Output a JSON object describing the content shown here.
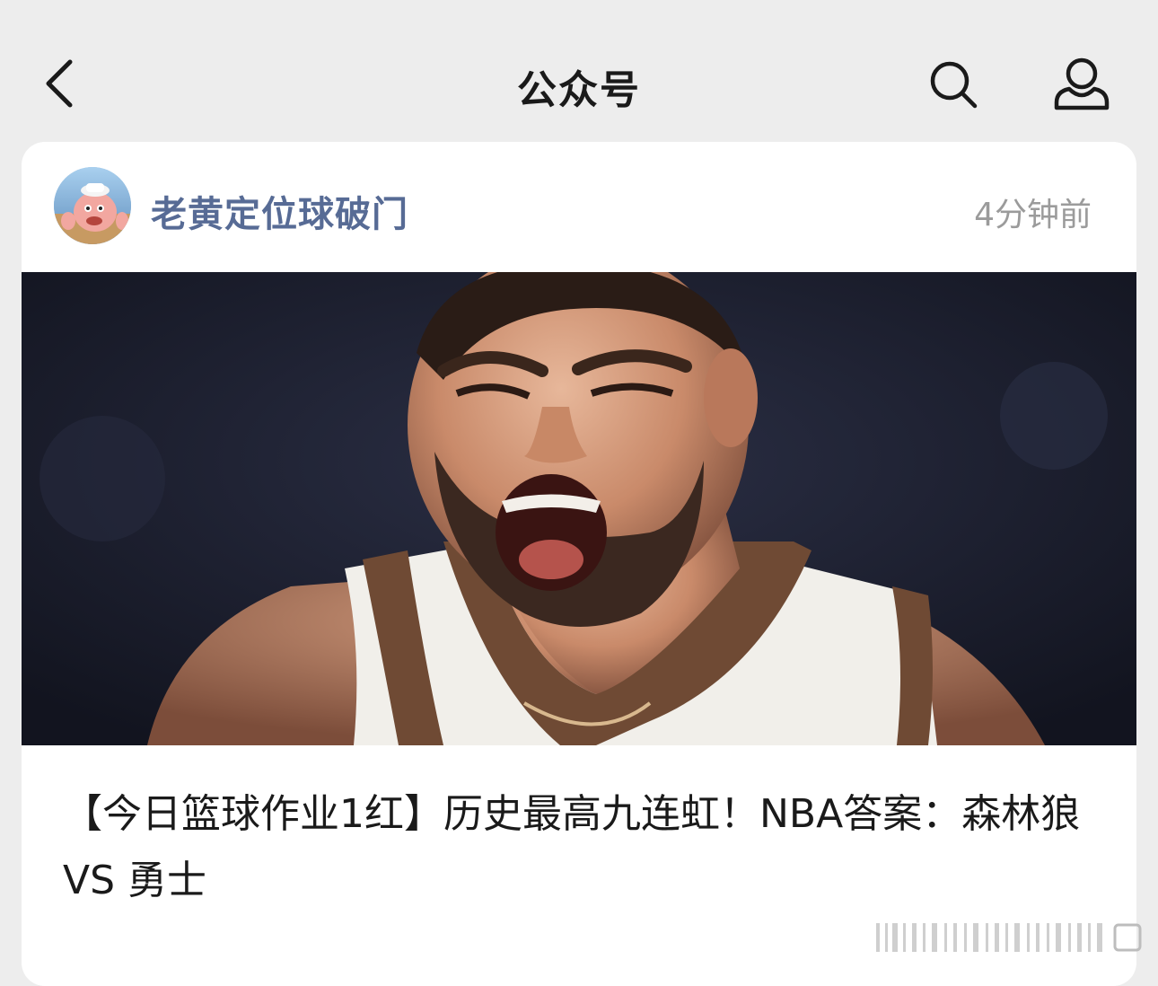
{
  "nav": {
    "back_icon": "chevron-left-icon",
    "title": "公众号",
    "search_icon": "search-icon",
    "profile_icon": "person-icon"
  },
  "post": {
    "account_name": "老黄定位球破门",
    "time": "4分钟前",
    "cover_image": "basketball player shouting in white and brown jersey",
    "title": "【今日篮球作业1红】历史最高九连虹！NBA答案：森林狼 VS 勇士"
  },
  "colors": {
    "background": "#ededed",
    "card": "#ffffff",
    "account_name": "#576b95",
    "time": "#9b9b9b",
    "title": "#1a1a1a"
  }
}
